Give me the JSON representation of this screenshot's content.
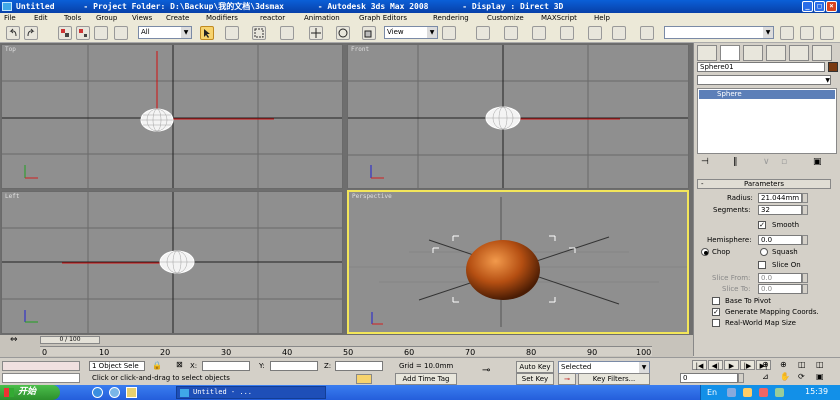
{
  "window": {
    "title": "Untitled      - Project Folder: D:\\Backup\\我的文档\\3dsmax       - Autodesk 3ds Max 2008       - Display : Direct 3D",
    "controls": [
      "_",
      "□",
      "×"
    ]
  },
  "menu": [
    "File",
    "Edit",
    "Tools",
    "Group",
    "Views",
    "Create",
    "Modifiers",
    "reactor",
    "Animation",
    "Graph Editors",
    "Rendering",
    "Customize",
    "MAXScript",
    "Help"
  ],
  "toolbar": {
    "selection_filter": "All",
    "coord_system": "View"
  },
  "viewports": {
    "top": "Top",
    "front": "Front",
    "left": "Left",
    "perspective": "Perspective"
  },
  "command_panel": {
    "object_name": "Sphere01",
    "object_color": "#7a3a12",
    "modifier_dropdown": "",
    "stack_item": "Sphere",
    "rollout_title": "Parameters",
    "radius_label": "Radius:",
    "radius_value": "21.044mm",
    "segments_label": "Segments:",
    "segments_value": "32",
    "smooth_label": "Smooth",
    "smooth_checked": true,
    "hemisphere_label": "Hemisphere:",
    "hemisphere_value": "0.0",
    "chop_label": "Chop",
    "squash_label": "Squash",
    "slice_on_label": "Slice On",
    "slice_from_label": "Slice From:",
    "slice_from_value": "0.0",
    "slice_to_label": "Slice To:",
    "slice_to_value": "0.0",
    "base_to_pivot_label": "Base To Pivot",
    "gen_mapping_label": "Generate Mapping Coords.",
    "gen_mapping_checked": true,
    "real_world_label": "Real-World Map Size"
  },
  "timeline": {
    "frame_indicator": "0 / 100",
    "ticks": [
      "0",
      "10",
      "20",
      "30",
      "40",
      "50",
      "60",
      "70",
      "80",
      "90",
      "100"
    ]
  },
  "status": {
    "selection_count": "1 Object Sele",
    "x_label": "X:",
    "y_label": "Y:",
    "z_label": "Z:",
    "grid": "Grid = 10.0mm",
    "prompt": "Click or click-and-drag to select objects",
    "add_time_tag": "Add Time Tag",
    "auto_key": "Auto Key",
    "set_key": "Set Key",
    "key_mode": "Selected",
    "key_filters": "Key Filters...",
    "current_frame": "0"
  },
  "taskbar": {
    "start": "开始",
    "task": "Untitled      - ...",
    "clock": "15:39"
  }
}
